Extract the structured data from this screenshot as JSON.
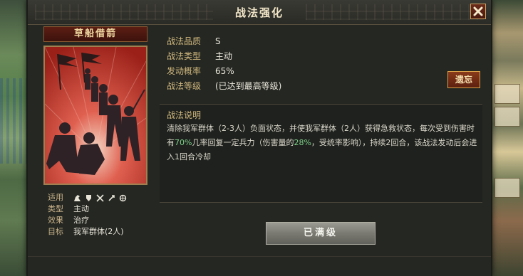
{
  "dialog": {
    "title": "战法强化",
    "close_label": "✕"
  },
  "card": {
    "name": "草船借箭"
  },
  "props": {
    "apply_label": "适用",
    "type_label": "类型",
    "type_value": "主动",
    "effect_label": "效果",
    "effect_value": "治疗",
    "target_label": "目标",
    "target_value": "我军群体(2人)",
    "apply_icons": [
      "cavalry-icon",
      "shield-icon",
      "crossed-spears-icon",
      "bow-icon",
      "chariot-icon"
    ]
  },
  "info": {
    "quality_label": "战法品质",
    "quality_value": "S",
    "type_label": "战法类型",
    "type_value": "主动",
    "chance_label": "发动概率",
    "chance_value": "65%",
    "level_label": "战法等级",
    "level_value": "(已达到最高等级)",
    "remove_button": "遗忘"
  },
  "description": {
    "title": "战法说明",
    "text_a": "清除我军群体（2-3人）负面状态，并使我军群体（2人）获得急救状态，每次受到伤害时有",
    "pct1": "70%",
    "text_b": "几率回复一定兵力（伤害量的",
    "pct2": "28%",
    "text_c": "，受统率影响），持续2回合，该战法发动后会进入1回合冷却"
  },
  "footer": {
    "max_button": "已满级"
  },
  "colors": {
    "accent_gold": "#d2b87e",
    "highlight_green": "#7fd08a",
    "card_red": "#c03a2a"
  }
}
